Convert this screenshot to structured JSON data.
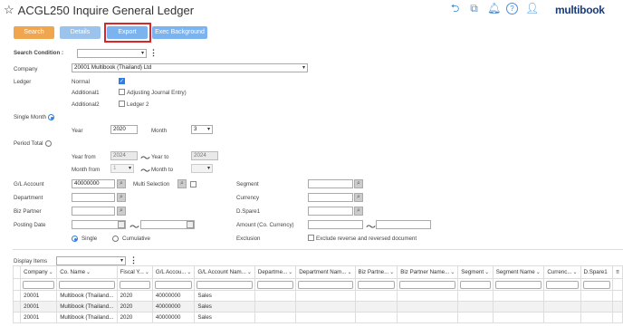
{
  "header": {
    "title": "ACGL250 Inquire General Ledger",
    "logo": "multibook",
    "icons": [
      "back-icon",
      "export-window-icon",
      "bell-icon",
      "help-icon",
      "user-icon"
    ]
  },
  "toolbar": {
    "search_label": "Search",
    "details_label": "Details",
    "export_label": "Export",
    "exec_background_label": "Exec Background",
    "colors": {
      "search": "#f0a64f",
      "details": "#9cc3ec",
      "export": "#7ab3f0",
      "exec": "#7ab3f0",
      "highlight": "#d9262b"
    }
  },
  "search_condition": {
    "label": "Search Condition :",
    "value": ""
  },
  "company": {
    "label": "Company",
    "value": "20001 Multibook (Thailand) Ltd"
  },
  "ledger": {
    "label": "Ledger",
    "normal_label": "Normal",
    "normal_checked": true,
    "additional1_label": "Additional1",
    "additional1_option": "Adjusting Journal Entry)",
    "additional1_checked": false,
    "additional2_label": "Additional2",
    "additional2_option": "Ledger 2",
    "additional2_checked": false
  },
  "period": {
    "single_month_label": "Single Month",
    "single_month_selected": true,
    "year_label": "Year",
    "year_value": "2020",
    "month_label": "Month",
    "month_value": "3",
    "period_total_label": "Period Total",
    "year_from_label": "Year from",
    "year_from_value": "2024",
    "year_to_label": "Year to",
    "year_to_value": "2024",
    "month_from_label": "Month from",
    "month_from_value": "1",
    "month_to_label": "Month to",
    "month_to_value": "",
    "tilde": "〜"
  },
  "filters": {
    "gl_account_label": "G/L Account",
    "gl_account_value": "40000000",
    "multi_selection_label": "Multi Selection",
    "department_label": "Department",
    "biz_partner_label": "Biz Partner",
    "posting_date_label": "Posting Date",
    "segment_label": "Segment",
    "currency_label": "Currency",
    "dspare1_label": "D.Spare1",
    "amount_label": "Amount (Co. Currency)",
    "exclusion_label": "Exclusion",
    "exclusion_option": "Exclude reverse and reversed document",
    "single_label": "Single",
    "cumulative_label": "Cumulative"
  },
  "display_items": {
    "label": "Display Items",
    "value": ""
  },
  "table": {
    "columns": [
      "Company",
      "Co. Name",
      "Fiscal Y...",
      "G/L Accou...",
      "G/L Account Nam...",
      "Departme...",
      "Department Nam...",
      "Biz Partne...",
      "Biz Partner Name...",
      "Segment",
      "Segment Name",
      "Currenc...",
      "D.Spare1"
    ],
    "rows": [
      [
        "20001",
        "Multibook (Thailand...",
        "2020",
        "40000000",
        "Sales",
        "",
        "",
        "",
        "",
        "",
        "",
        "",
        ""
      ],
      [
        "20001",
        "Multibook (Thailand...",
        "2020",
        "40000000",
        "Sales",
        "",
        "",
        "",
        "",
        "",
        "",
        "",
        ""
      ],
      [
        "20001",
        "Multibook (Thailand...",
        "2020",
        "40000000",
        "Sales",
        "",
        "",
        "",
        "",
        "",
        "",
        "",
        ""
      ]
    ]
  }
}
